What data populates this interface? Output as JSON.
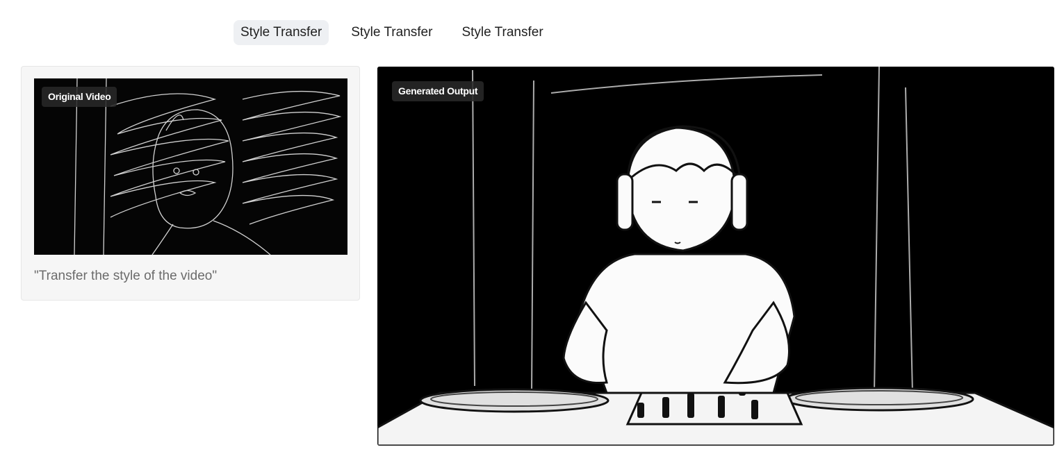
{
  "tabs": [
    {
      "label": "Style Transfer",
      "active": true
    },
    {
      "label": "Style Transfer",
      "active": false
    },
    {
      "label": "Style Transfer",
      "active": false
    }
  ],
  "input_card": {
    "badge": "Original Video",
    "prompt": "\"Transfer the style of the video\""
  },
  "output_card": {
    "badge": "Generated Output"
  },
  "colors": {
    "active_tab_bg": "#eef0f3",
    "card_bg": "#f6f6f6",
    "badge_bg": "#282828",
    "video_bg": "#000000"
  }
}
